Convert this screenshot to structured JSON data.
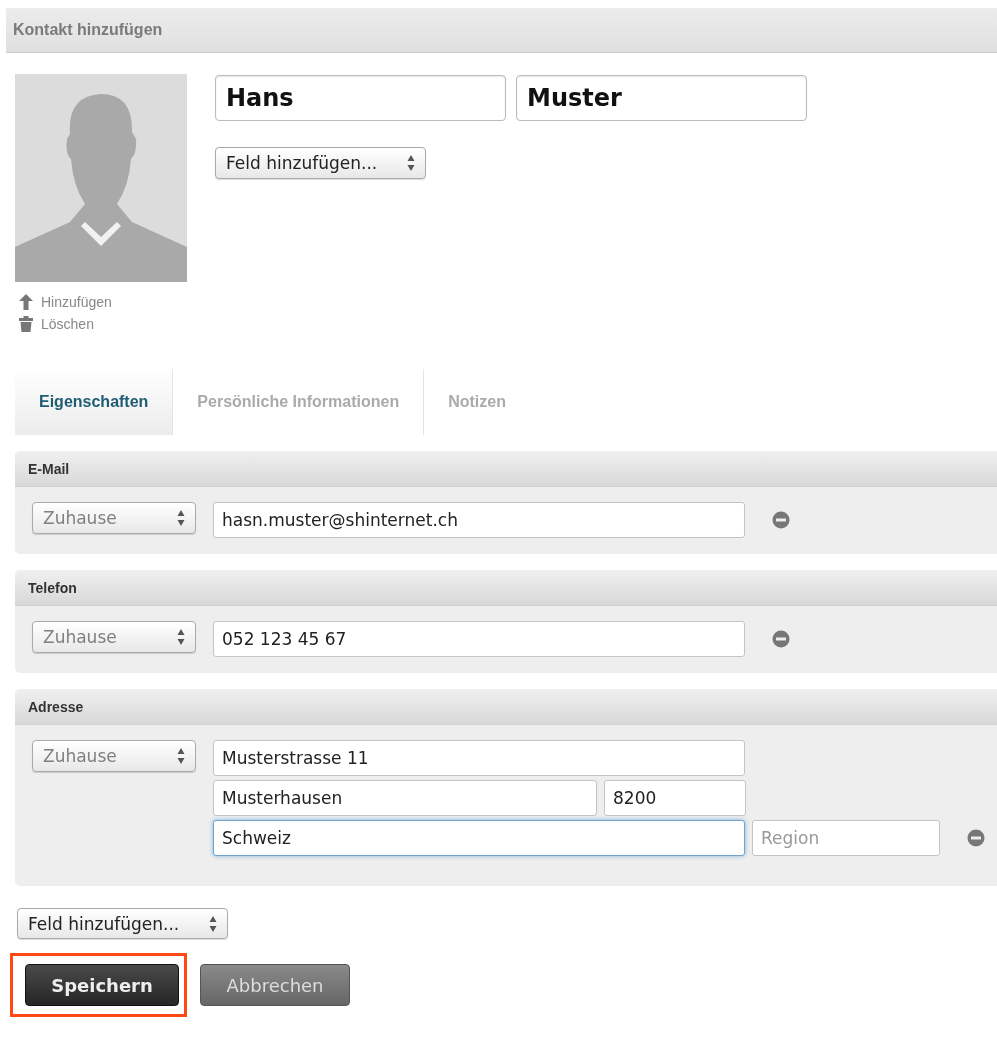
{
  "window": {
    "title": "Kontakt hinzufügen"
  },
  "photo_actions": [
    {
      "kind": "upload",
      "label": "Hinzufügen"
    },
    {
      "kind": "delete",
      "label": "Löschen"
    }
  ],
  "name_fields": [
    {
      "value": "Hans"
    },
    {
      "value": "Muster"
    }
  ],
  "add_field_top": {
    "label": "Feld hinzufügen..."
  },
  "tabs": [
    {
      "label": "Eigenschaften",
      "selected": true
    },
    {
      "label": "Persönliche Informationen",
      "selected": false
    },
    {
      "label": "Notizen",
      "selected": false
    }
  ],
  "sections": [
    {
      "title": "E-Mail",
      "type_select": "Zuhause",
      "rows": [
        [
          {
            "kind": "full",
            "value": "hasn.muster@shinternet.ch",
            "focused": false
          }
        ]
      ]
    },
    {
      "title": "Telefon",
      "type_select": "Zuhause",
      "rows": [
        [
          {
            "kind": "full",
            "value": "052 123 45 67",
            "focused": false
          }
        ]
      ]
    },
    {
      "title": "Adresse",
      "type_select": "Zuhause",
      "rows": [
        [
          {
            "kind": "full",
            "value": "Musterstrasse 11",
            "focused": false
          }
        ],
        [
          {
            "kind": "city",
            "value": "Musterhausen",
            "focused": false
          },
          {
            "kind": "zip",
            "value": "8200",
            "focused": false
          }
        ],
        [
          {
            "kind": "full",
            "value": "Schweiz",
            "focused": true
          },
          {
            "kind": "region",
            "placeholder": "Region",
            "focused": false
          }
        ]
      ]
    }
  ],
  "add_field_bottom": {
    "label": "Feld hinzufügen..."
  },
  "buttons": [
    {
      "kind": "primary",
      "label": "Speichern",
      "highlighted": true
    },
    {
      "kind": "secondary",
      "label": "Abbrechen",
      "highlighted": false
    }
  ]
}
